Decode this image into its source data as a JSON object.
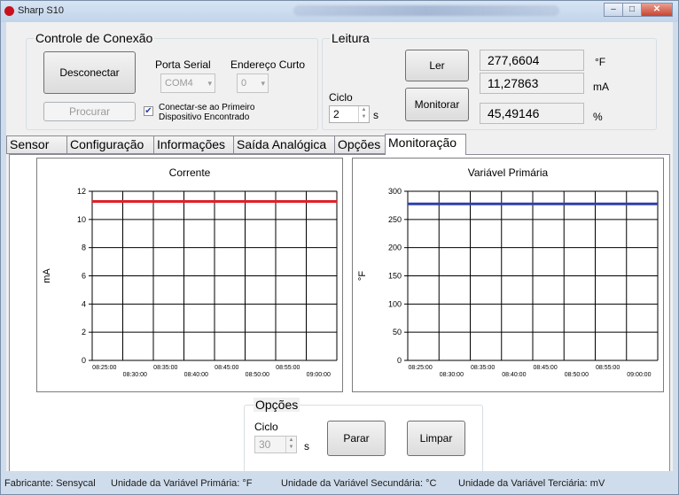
{
  "window": {
    "title": "Sharp S10"
  },
  "conexao": {
    "title": "Controle de Conexão",
    "disconnect_label": "Desconectar",
    "search_label": "Procurar",
    "port_label": "Porta Serial",
    "port_value": "COM4",
    "address_label": "Endereço Curto",
    "address_value": "0",
    "checkbox_checked": true,
    "checkbox_label_1": "Conectar-se ao Primeiro",
    "checkbox_label_2": "Dispositivo Encontrado"
  },
  "leitura": {
    "title": "Leitura",
    "read_label": "Ler",
    "monitor_label": "Monitorar",
    "cycle_label": "Ciclo",
    "cycle_value": "2",
    "cycle_unit": "s",
    "values": [
      {
        "value": "277,6604",
        "unit": "°F"
      },
      {
        "value": "11,27863",
        "unit": "mA"
      },
      {
        "value": "45,49146",
        "unit": "%"
      }
    ]
  },
  "tabs": [
    {
      "label": "Sensor"
    },
    {
      "label": "Configuração"
    },
    {
      "label": "Informações"
    },
    {
      "label": "Saída Analógica"
    },
    {
      "label": "Opções"
    },
    {
      "label": "Monitoração"
    }
  ],
  "active_tab": "Monitoração",
  "chart_data": [
    {
      "type": "line",
      "title": "Corrente",
      "ylabel": "mA",
      "xlabel": "",
      "ylim": [
        0,
        12
      ],
      "yticks": [
        0,
        2,
        4,
        6,
        8,
        10,
        12
      ],
      "x_ticks_upper": [
        "08:25:00",
        "08:35:00",
        "08:45:00",
        "08:55:00"
      ],
      "x_ticks_lower": [
        "08:30:00",
        "08:40:00",
        "08:50:00",
        "09:00:00"
      ],
      "series": [
        {
          "color": "#e0202a",
          "values": [
            11.28,
            11.28
          ]
        }
      ],
      "grid": true
    },
    {
      "type": "line",
      "title": "Variável Primária",
      "ylabel": "°F",
      "xlabel": "",
      "ylim": [
        0,
        300
      ],
      "yticks": [
        0,
        50,
        100,
        150,
        200,
        250,
        300
      ],
      "x_ticks_upper": [
        "08:25:00",
        "08:35:00",
        "08:45:00",
        "08:55:00"
      ],
      "x_ticks_lower": [
        "08:30:00",
        "08:40:00",
        "08:50:00",
        "09:00:00"
      ],
      "series": [
        {
          "color": "#2f3fa8",
          "values": [
            277.66,
            277.66
          ]
        }
      ],
      "grid": true
    }
  ],
  "opcoes": {
    "title": "Opções",
    "cycle_label": "Ciclo",
    "cycle_value": "30",
    "cycle_unit": "s",
    "stop_label": "Parar",
    "clear_label": "Limpar"
  },
  "statusbar": {
    "manufacturer": "Fabricante: Sensycal",
    "primary_unit": "Unidade da Variável Primária: °F",
    "secondary_unit": "Unidade da Variável Secundária: °C",
    "tertiary_unit": "Unidade da Variável Terciária: mV"
  }
}
